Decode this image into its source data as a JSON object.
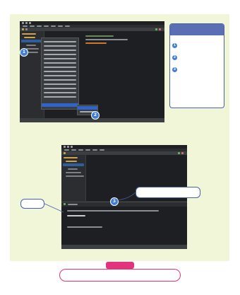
{
  "page": {
    "intro_text": "",
    "page_number": ""
  },
  "steps_box": {
    "title": "",
    "steps": [
      {
        "number": "1",
        "text": ""
      },
      {
        "number": "2",
        "text": ""
      },
      {
        "number": "3",
        "text": ""
      }
    ]
  },
  "figure1": {
    "badges": [
      "1",
      "2"
    ]
  },
  "figure2": {
    "badge": "3",
    "output_callout": "",
    "side_label": ""
  },
  "info_note": {
    "title": "",
    "body": ""
  },
  "colors": {
    "callout_border": "#4b62a8",
    "callout_header": "#5a6fb3",
    "step_badge": "#3f7fd3",
    "note_accent": "#e3337c",
    "panel_background": "#f2f6d9",
    "ide_background": "#2b2d30",
    "menu_highlight": "#2f65ca"
  },
  "icons": {
    "run": "play-icon",
    "folder": "folder-icon"
  }
}
